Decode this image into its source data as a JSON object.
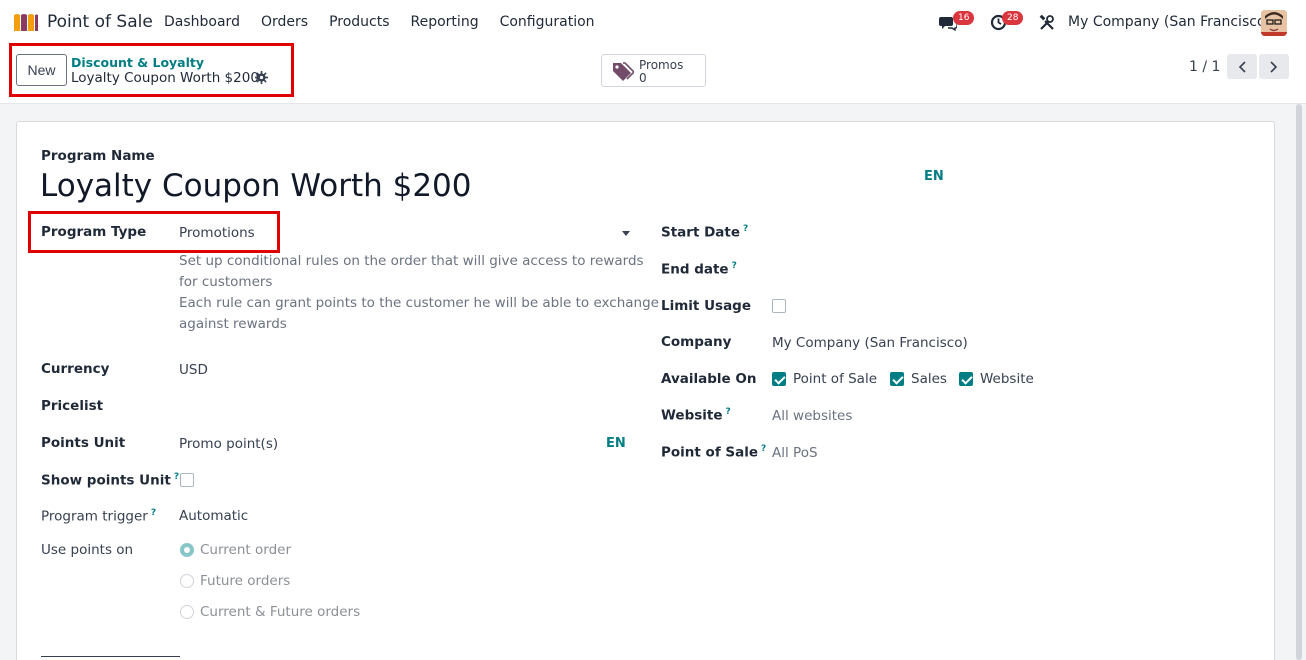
{
  "navbar": {
    "app_name": "Point of Sale",
    "menu": [
      "Dashboard",
      "Orders",
      "Products",
      "Reporting",
      "Configuration"
    ],
    "messages_count": "16",
    "activities_count": "28",
    "company": "My Company (San Francisco)"
  },
  "control": {
    "new_label": "New",
    "breadcrumb_parent": "Discount & Loyalty",
    "breadcrumb_current": "Loyalty Coupon Worth $200",
    "promos_label": "Promos",
    "promos_count": "0",
    "pager": "1 / 1"
  },
  "form": {
    "program_name_label": "Program Name",
    "program_name": "Loyalty Coupon Worth $200",
    "lang": "EN",
    "program_type_label": "Program Type",
    "program_type": "Promotions",
    "program_type_help_1": "Set up conditional rules on the order that will give access to rewards",
    "program_type_help_2": "for customers",
    "program_type_help_3": "Each rule can grant points to the customer he will be able to exchange",
    "program_type_help_4": "against rewards",
    "currency_label": "Currency",
    "currency": "USD",
    "pricelist_label": "Pricelist",
    "points_unit_label": "Points Unit",
    "points_unit": "Promo point(s)",
    "points_unit_lang": "EN",
    "show_points_unit_label": "Show points Unit",
    "program_trigger_label": "Program trigger",
    "program_trigger": "Automatic",
    "use_points_on_label": "Use points on",
    "use_points_options": [
      "Current order",
      "Future orders",
      "Current & Future orders"
    ],
    "start_date_label": "Start Date",
    "end_date_label": "End date",
    "limit_usage_label": "Limit Usage",
    "company_label": "Company",
    "company": "My Company (San Francisco)",
    "available_on_label": "Available On",
    "available_on": [
      "Point of Sale",
      "Sales",
      "Website"
    ],
    "website_label": "Website",
    "website": "All websites",
    "pos_label": "Point of Sale",
    "pos": "All PoS",
    "help_mark": "?"
  },
  "colors": {
    "accent": "#017e84",
    "highlight": "#e00000",
    "badge": "#d9363e"
  }
}
